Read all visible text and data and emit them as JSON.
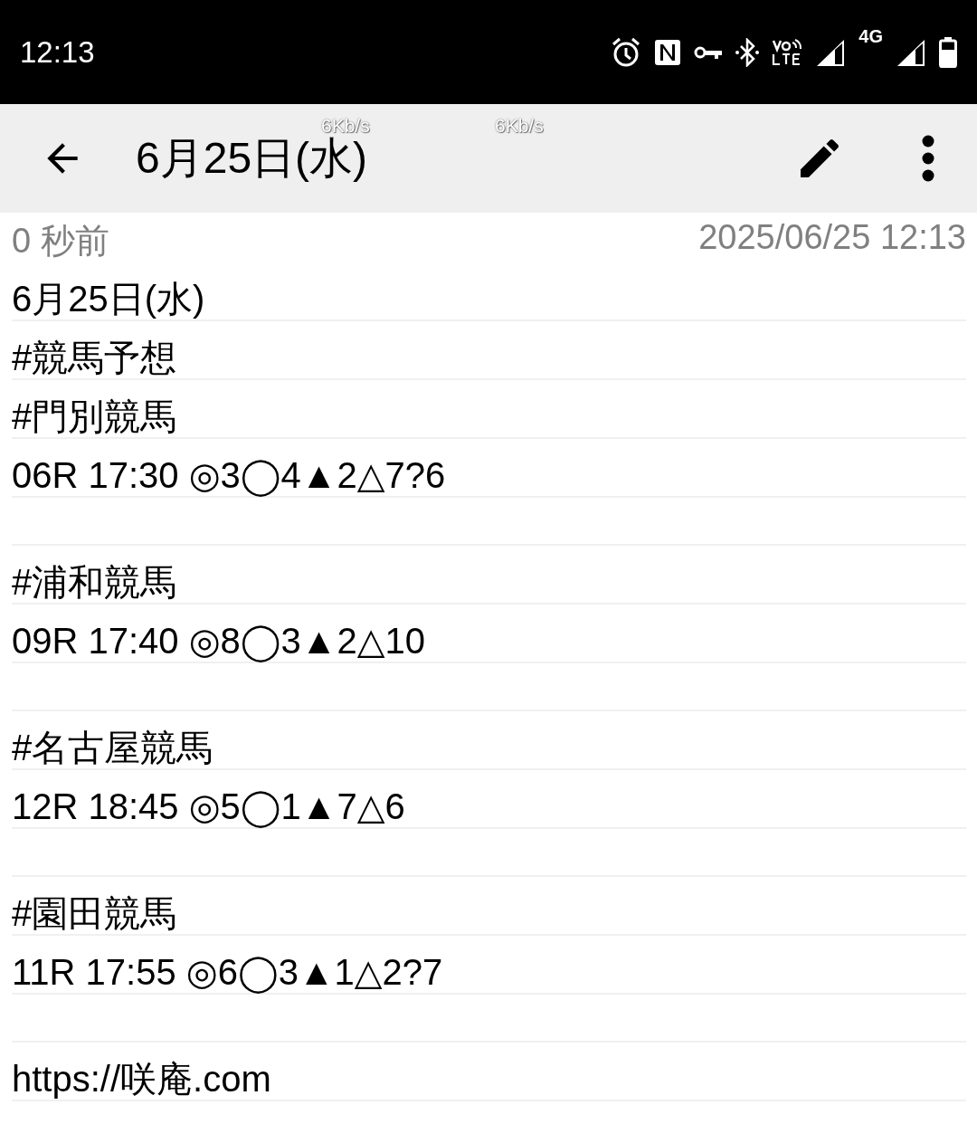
{
  "status_bar": {
    "time": "12:13",
    "network": "4G"
  },
  "toolbar": {
    "title": "6月25日(水)",
    "speed_overlays": [
      "6Kb/s",
      "6Kb/s"
    ]
  },
  "meta": {
    "relative_time": "0 秒前",
    "timestamp": "2025/06/25 12:13"
  },
  "note": {
    "paragraphs": [
      [
        "6月25日(水)",
        "#競馬予想",
        "#門別競馬",
        "06R 17:30 ◎3◯4▲2△7?6"
      ],
      [
        "#浦和競馬",
        "09R 17:40 ◎8◯3▲2△10"
      ],
      [
        "#名古屋競馬",
        "12R 18:45 ◎5◯1▲7△6"
      ],
      [
        "#園田競馬",
        "11R 17:55 ◎6◯3▲1△2?7"
      ],
      [
        "https://咲庵.com"
      ]
    ]
  }
}
